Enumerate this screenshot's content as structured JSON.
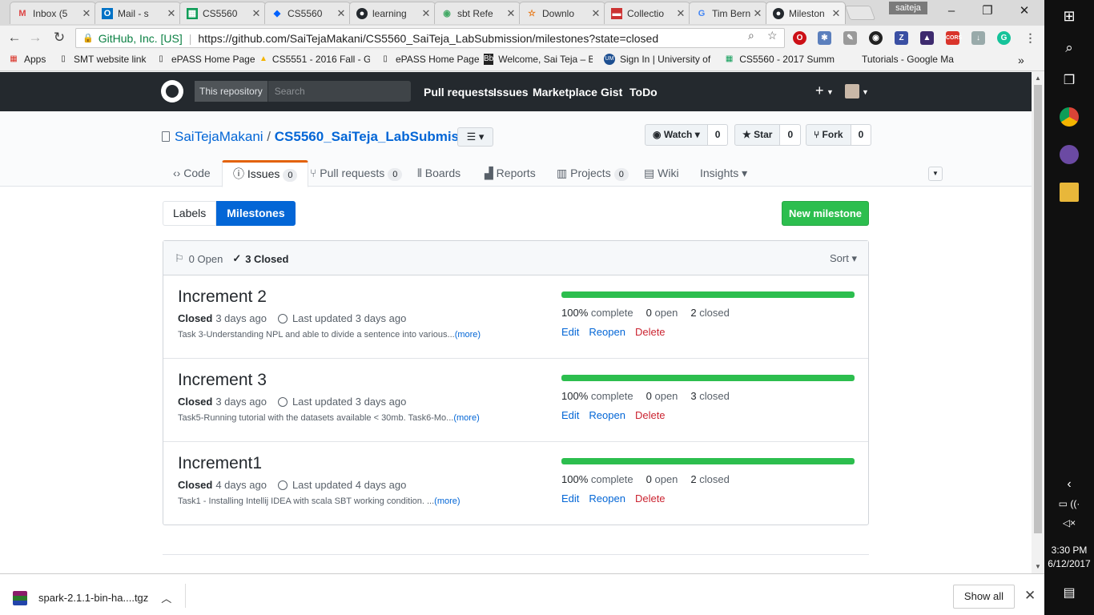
{
  "browser": {
    "tabs": [
      {
        "title": "Inbox (5",
        "icon": "gmail-icon"
      },
      {
        "title": "Mail - s",
        "icon": "outlook-icon"
      },
      {
        "title": "CS5560",
        "icon": "sheets-icon"
      },
      {
        "title": "CS5560",
        "icon": "dropbox-icon"
      },
      {
        "title": "learning",
        "icon": "github-icon"
      },
      {
        "title": "sbt Refe",
        "icon": "sbt-icon"
      },
      {
        "title": "Downlo",
        "icon": "star-icon"
      },
      {
        "title": "Collectio",
        "icon": "collection-icon"
      },
      {
        "title": "Tim Bern",
        "icon": "google-icon"
      },
      {
        "title": "Mileston",
        "icon": "github-icon"
      }
    ],
    "profile": "saiteja",
    "omnibox": {
      "secure_label": "GitHub, Inc. [US]",
      "url": "https://github.com/SaiTejaMakani/CS5560_SaiTeja_LabSubmission/milestones?state=closed"
    },
    "bookmarks": [
      {
        "label": "Apps"
      },
      {
        "label": "SMT website link"
      },
      {
        "label": "ePASS Home Page"
      },
      {
        "label": "CS5551 - 2016 Fall - G"
      },
      {
        "label": "ePASS Home Page"
      },
      {
        "label": "Welcome, Sai Teja – B"
      },
      {
        "label": "Sign In | University of"
      },
      {
        "label": "CS5560 - 2017 Summ"
      },
      {
        "label": "Tutorials - Google Ma"
      }
    ],
    "bookmarks_more": "»"
  },
  "header": {
    "scope": "This repository",
    "search_placeholder": "Search",
    "nav": [
      "Pull requests",
      "Issues",
      "Marketplace",
      "Gist",
      "ToDo"
    ],
    "plus": "+"
  },
  "repo": {
    "owner": "SaiTejaMakani",
    "slash": "/",
    "name": "CS5560_SaiTeja_LabSubmission",
    "watch_label": "Watch",
    "watch_count": "0",
    "star_label": "Star",
    "star_count": "0",
    "fork_label": "Fork",
    "fork_count": "0",
    "tabs": [
      {
        "label": "Code",
        "count": ""
      },
      {
        "label": "Issues",
        "count": "0"
      },
      {
        "label": "Pull requests",
        "count": "0"
      },
      {
        "label": "Boards",
        "count": ""
      },
      {
        "label": "Reports",
        "count": ""
      },
      {
        "label": "Projects",
        "count": "0"
      },
      {
        "label": "Wiki",
        "count": ""
      },
      {
        "label": "Insights",
        "count": ""
      }
    ]
  },
  "subnav": {
    "labels": "Labels",
    "milestones": "Milestones",
    "new_milestone": "New milestone"
  },
  "milestones_box": {
    "open_label": "0 Open",
    "closed_label": "3 Closed",
    "sort_label": "Sort"
  },
  "milestones": [
    {
      "title": "Increment 2",
      "status": "Closed",
      "closed_ago": "3 days ago",
      "updated": "Last updated 3 days ago",
      "desc": "Task 3-Understanding NPL and able to divide a sentence into various...",
      "more": "(more)",
      "progress": 1.0,
      "percent": "100%",
      "percent_label": "complete",
      "open": "0",
      "open_label": "open",
      "closed": "2",
      "closed_label": "closed"
    },
    {
      "title": "Increment 3",
      "status": "Closed",
      "closed_ago": "3 days ago",
      "updated": "Last updated 3 days ago",
      "desc": "Task5-Running tutorial with the datasets available < 30mb. Task6-Mo...",
      "more": "(more)",
      "progress": 1.0,
      "percent": "100%",
      "percent_label": "complete",
      "open": "0",
      "open_label": "open",
      "closed": "3",
      "closed_label": "closed"
    },
    {
      "title": "Increment1",
      "status": "Closed",
      "closed_ago": "4 days ago",
      "updated": "Last updated 4 days ago",
      "desc": "Task1 - Installing Intellij IDEA with scala SBT working condition. ...",
      "more": "(more)",
      "progress": 1.0,
      "percent": "100%",
      "percent_label": "complete",
      "open": "0",
      "open_label": "open",
      "closed": "2",
      "closed_label": "closed"
    }
  ],
  "actions": {
    "edit": "Edit",
    "reopen": "Reopen",
    "delete": "Delete"
  },
  "downloads": {
    "file": "spark-2.1.1-bin-ha....tgz",
    "show_all": "Show all"
  },
  "taskbar": {
    "time": "3:30 PM",
    "date": "6/12/2017"
  },
  "colors": {
    "github_dark": "#24292e",
    "link": "#0366d6",
    "green": "#2cbe4e",
    "delete": "#cb2431",
    "issues_tab_accent": "#e36209"
  }
}
